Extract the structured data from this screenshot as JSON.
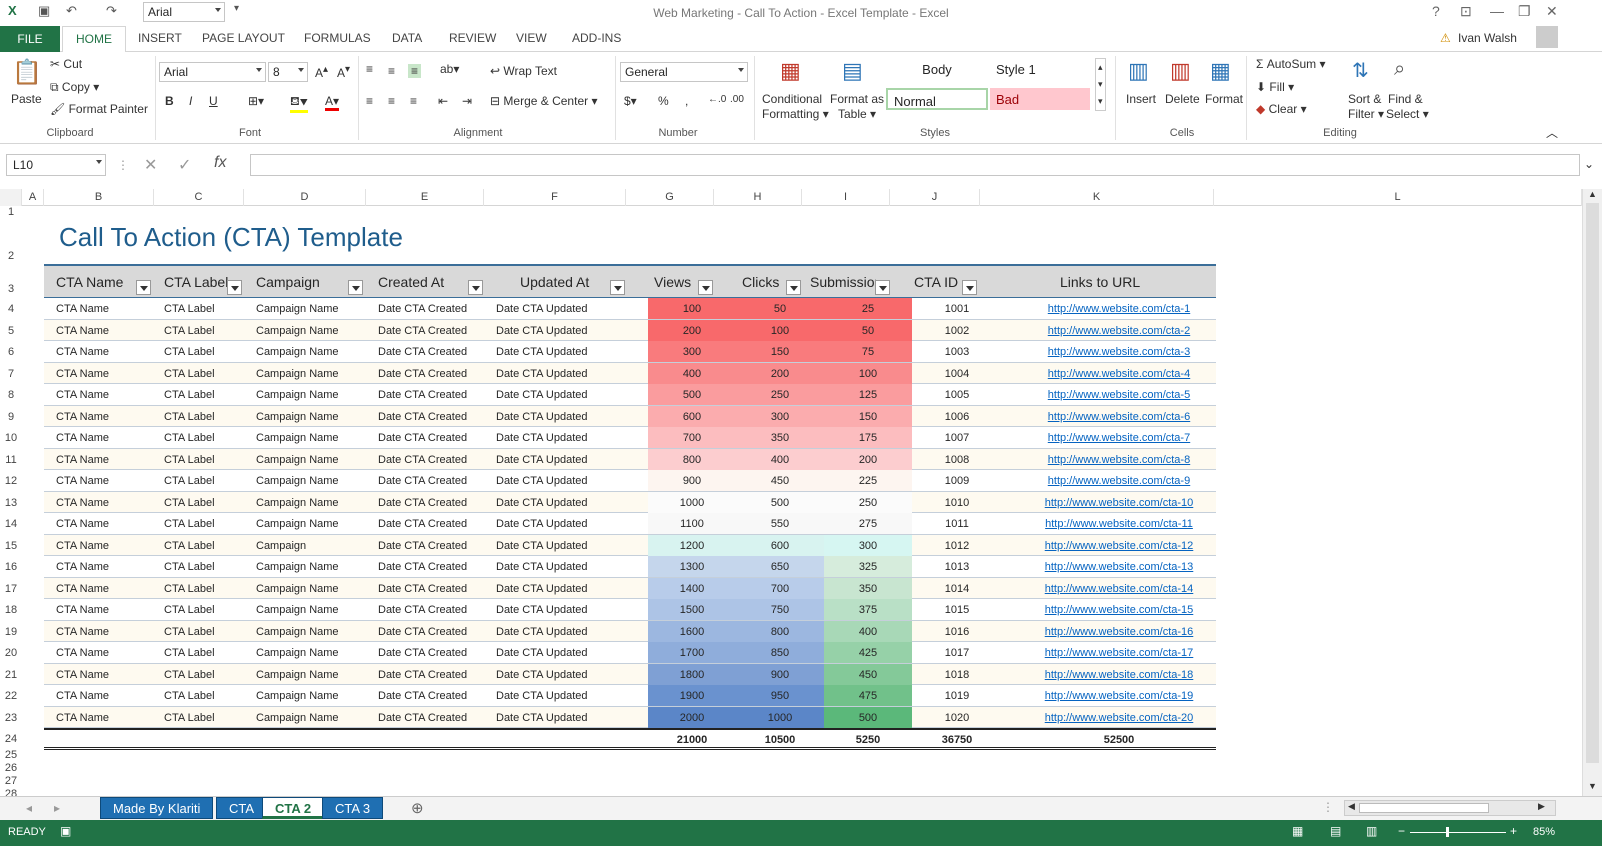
{
  "window": {
    "title": "Web Marketing - Call To Action - Excel Template - Excel",
    "help": "?",
    "user": "Ivan Walsh"
  },
  "qat": {
    "font_name": "Arial"
  },
  "ribbon_tabs": [
    "FILE",
    "HOME",
    "INSERT",
    "PAGE LAYOUT",
    "FORMULAS",
    "DATA",
    "REVIEW",
    "VIEW",
    "ADD-INS"
  ],
  "clipboard": {
    "paste": "Paste",
    "cut": "Cut",
    "copy": "Copy",
    "format_painter": "Format Painter",
    "label": "Clipboard"
  },
  "font": {
    "name": "Arial",
    "size": "8",
    "bold": "B",
    "italic": "I",
    "underline": "U",
    "label": "Font"
  },
  "alignment": {
    "wrap": "Wrap Text",
    "merge": "Merge & Center",
    "label": "Alignment"
  },
  "number": {
    "format": "General",
    "percent": "%",
    "comma": ",",
    "label": "Number"
  },
  "styles": {
    "conditional": "Conditional",
    "conditional2": "Formatting",
    "format_as": "Format as",
    "table": "Table",
    "body": "Body",
    "style1": "Style 1",
    "normal": "Normal",
    "bad": "Bad",
    "label": "Styles"
  },
  "cells": {
    "insert": "Insert",
    "delete": "Delete",
    "format": "Format",
    "label": "Cells"
  },
  "editing": {
    "autosum": "AutoSum",
    "fill": "Fill",
    "clear": "Clear",
    "sort": "Sort &",
    "filter": "Filter",
    "find": "Find &",
    "select": "Select",
    "label": "Editing"
  },
  "formula_bar": {
    "name_box": "L10",
    "value": ""
  },
  "columns": [
    "A",
    "B",
    "C",
    "D",
    "E",
    "F",
    "G",
    "H",
    "I",
    "J",
    "K",
    "L"
  ],
  "rows": [
    "1",
    "2",
    "3",
    "4",
    "5",
    "6",
    "7",
    "8",
    "9",
    "10",
    "11",
    "12",
    "13",
    "14",
    "15",
    "16",
    "17",
    "18",
    "19",
    "20",
    "21",
    "22",
    "23",
    "24",
    "25",
    "26",
    "27",
    "28"
  ],
  "sheet": {
    "title": "Call To Action (CTA) Template",
    "headers": [
      "CTA Name",
      "CTA Label",
      "Campaign",
      "Created At",
      "Updated At",
      "Views",
      "Clicks",
      "Submission",
      "CTA ID",
      "Links to URL"
    ],
    "rows": [
      {
        "name": "CTA Name",
        "label": "CTA Label",
        "campaign": "Campaign Name",
        "created": "Date CTA Created",
        "updated": "Date CTA Updated",
        "views": "100",
        "clicks": "50",
        "subs": "25",
        "id": "1001",
        "url": "http://www.website.com/cta-1"
      },
      {
        "name": "CTA Name",
        "label": "CTA Label",
        "campaign": "Campaign Name",
        "created": "Date CTA Created",
        "updated": "Date CTA Updated",
        "views": "200",
        "clicks": "100",
        "subs": "50",
        "id": "1002",
        "url": "http://www.website.com/cta-2"
      },
      {
        "name": "CTA Name",
        "label": "CTA Label",
        "campaign": "Campaign Name",
        "created": "Date CTA Created",
        "updated": "Date CTA Updated",
        "views": "300",
        "clicks": "150",
        "subs": "75",
        "id": "1003",
        "url": "http://www.website.com/cta-3"
      },
      {
        "name": "CTA Name",
        "label": "CTA Label",
        "campaign": "Campaign Name",
        "created": "Date CTA Created",
        "updated": "Date CTA Updated",
        "views": "400",
        "clicks": "200",
        "subs": "100",
        "id": "1004",
        "url": "http://www.website.com/cta-4"
      },
      {
        "name": "CTA Name",
        "label": "CTA Label",
        "campaign": "Campaign Name",
        "created": "Date CTA Created",
        "updated": "Date CTA Updated",
        "views": "500",
        "clicks": "250",
        "subs": "125",
        "id": "1005",
        "url": "http://www.website.com/cta-5"
      },
      {
        "name": "CTA Name",
        "label": "CTA Label",
        "campaign": "Campaign Name",
        "created": "Date CTA Created",
        "updated": "Date CTA Updated",
        "views": "600",
        "clicks": "300",
        "subs": "150",
        "id": "1006",
        "url": "http://www.website.com/cta-6"
      },
      {
        "name": "CTA Name",
        "label": "CTA Label",
        "campaign": "Campaign Name",
        "created": "Date CTA Created",
        "updated": "Date CTA Updated",
        "views": "700",
        "clicks": "350",
        "subs": "175",
        "id": "1007",
        "url": "http://www.website.com/cta-7"
      },
      {
        "name": "CTA Name",
        "label": "CTA Label",
        "campaign": "Campaign Name",
        "created": "Date CTA Created",
        "updated": "Date CTA Updated",
        "views": "800",
        "clicks": "400",
        "subs": "200",
        "id": "1008",
        "url": "http://www.website.com/cta-8"
      },
      {
        "name": "CTA Name",
        "label": "CTA Label",
        "campaign": "Campaign Name",
        "created": "Date CTA Created",
        "updated": "Date CTA Updated",
        "views": "900",
        "clicks": "450",
        "subs": "225",
        "id": "1009",
        "url": "http://www.website.com/cta-9"
      },
      {
        "name": "CTA Name",
        "label": "CTA Label",
        "campaign": "Campaign Name",
        "created": "Date CTA Created",
        "updated": "Date CTA Updated",
        "views": "1000",
        "clicks": "500",
        "subs": "250",
        "id": "1010",
        "url": "http://www.website.com/cta-10"
      },
      {
        "name": "CTA Name",
        "label": "CTA Label",
        "campaign": "Campaign Name",
        "created": "Date CTA Created",
        "updated": "Date CTA Updated",
        "views": "1100",
        "clicks": "550",
        "subs": "275",
        "id": "1011",
        "url": "http://www.website.com/cta-11"
      },
      {
        "name": "CTA Name",
        "label": "CTA Label",
        "campaign": "Campaign",
        "created": "Date CTA Created",
        "updated": "Date CTA Updated",
        "views": "1200",
        "clicks": "600",
        "subs": "300",
        "id": "1012",
        "url": "http://www.website.com/cta-12"
      },
      {
        "name": "CTA Name",
        "label": "CTA Label",
        "campaign": "Campaign Name",
        "created": "Date CTA Created",
        "updated": "Date CTA Updated",
        "views": "1300",
        "clicks": "650",
        "subs": "325",
        "id": "1013",
        "url": "http://www.website.com/cta-13"
      },
      {
        "name": "CTA Name",
        "label": "CTA Label",
        "campaign": "Campaign Name",
        "created": "Date CTA Created",
        "updated": "Date CTA Updated",
        "views": "1400",
        "clicks": "700",
        "subs": "350",
        "id": "1014",
        "url": "http://www.website.com/cta-14"
      },
      {
        "name": "CTA Name",
        "label": "CTA Label",
        "campaign": "Campaign Name",
        "created": "Date CTA Created",
        "updated": "Date CTA Updated",
        "views": "1500",
        "clicks": "750",
        "subs": "375",
        "id": "1015",
        "url": "http://www.website.com/cta-15"
      },
      {
        "name": "CTA Name",
        "label": "CTA Label",
        "campaign": "Campaign Name",
        "created": "Date CTA Created",
        "updated": "Date CTA Updated",
        "views": "1600",
        "clicks": "800",
        "subs": "400",
        "id": "1016",
        "url": "http://www.website.com/cta-16"
      },
      {
        "name": "CTA Name",
        "label": "CTA Label",
        "campaign": "Campaign Name",
        "created": "Date CTA Created",
        "updated": "Date CTA Updated",
        "views": "1700",
        "clicks": "850",
        "subs": "425",
        "id": "1017",
        "url": "http://www.website.com/cta-17"
      },
      {
        "name": "CTA Name",
        "label": "CTA Label",
        "campaign": "Campaign Name",
        "created": "Date CTA Created",
        "updated": "Date CTA Updated",
        "views": "1800",
        "clicks": "900",
        "subs": "450",
        "id": "1018",
        "url": "http://www.website.com/cta-18"
      },
      {
        "name": "CTA Name",
        "label": "CTA Label",
        "campaign": "Campaign Name",
        "created": "Date CTA Created",
        "updated": "Date CTA Updated",
        "views": "1900",
        "clicks": "950",
        "subs": "475",
        "id": "1019",
        "url": "http://www.website.com/cta-19"
      },
      {
        "name": "CTA Name",
        "label": "CTA Label",
        "campaign": "Campaign Name",
        "created": "Date CTA Created",
        "updated": "Date CTA Updated",
        "views": "2000",
        "clicks": "1000",
        "subs": "500",
        "id": "1020",
        "url": "http://www.website.com/cta-20"
      }
    ],
    "totals": {
      "views": "21000",
      "clicks": "10500",
      "subs": "5250",
      "id": "36750",
      "url": "52500"
    }
  },
  "sheet_tabs": [
    "Made By Klariti",
    "CTA",
    "CTA 2",
    "CTA 3"
  ],
  "active_sheet": "CTA 2",
  "status": {
    "ready": "READY",
    "zoom": "85%"
  }
}
